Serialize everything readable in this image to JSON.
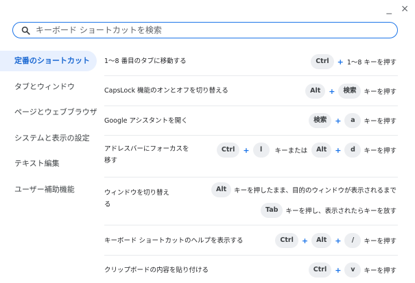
{
  "window": {
    "minimize_glyph": "_",
    "close_glyph": "×"
  },
  "search": {
    "placeholder": "キーボード ショートカットを検索",
    "value": "",
    "icon": "search-icon"
  },
  "sidebar": {
    "items": [
      {
        "label": "定番のショートカット",
        "active": true
      },
      {
        "label": "タブとウィンドウ",
        "active": false
      },
      {
        "label": "ページとウェブブラウザ",
        "active": false
      },
      {
        "label": "システムと表示の設定",
        "active": false
      },
      {
        "label": "テキスト編集",
        "active": false
      },
      {
        "label": "ユーザー補助機能",
        "active": false
      }
    ]
  },
  "shortcuts": [
    {
      "desc": "1〜8 番目のタブに移動する",
      "keys": {
        "k1": "Ctrl",
        "p1": "+",
        "t1": "1〜8 キーを押す"
      }
    },
    {
      "desc": "CapsLock 機能のオンとオフを切り替える",
      "keys": {
        "k1": "Alt",
        "p1": "+",
        "k2": "検索",
        "t1": "キーを押す"
      }
    },
    {
      "desc": "Google アシスタントを開く",
      "keys": {
        "k1": "検索",
        "p1": "+",
        "k2": "a",
        "t1": "キーを押す"
      }
    },
    {
      "desc_line1": "アドレスバーにフォーカスを",
      "desc_line2": "移す",
      "keys": {
        "k1": "Ctrl",
        "p1": "+",
        "k2": "l",
        "t1": "キーまたは",
        "k3": "Alt",
        "p2": "+",
        "k4": "d",
        "t2": "キーを押す"
      }
    },
    {
      "desc_line1": "ウィンドウを切り替え",
      "desc_line2": "る",
      "keys": {
        "k1": "Alt",
        "t1": "キーを押したまま、目的のウィンドウが表示されるまで",
        "k2": "Tab",
        "t2": "キーを押し、表示されたらキーを放す"
      }
    },
    {
      "desc": "キーボード ショートカットのヘルプを表示する",
      "keys": {
        "k1": "Ctrl",
        "p1": "+",
        "k2": "Alt",
        "p2": "+",
        "k3": "/",
        "t1": "キーを押す"
      }
    },
    {
      "desc": "クリップボードの内容を貼り付ける",
      "keys": {
        "k1": "Ctrl",
        "p1": "+",
        "k2": "v",
        "t1": "キーを押す"
      }
    }
  ],
  "colors": {
    "accent": "#1a73e8",
    "active_bg": "#e8f0fe",
    "key_bg": "#eceef1",
    "divider": "#e8eaed"
  }
}
